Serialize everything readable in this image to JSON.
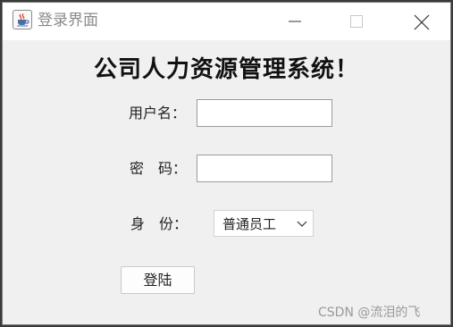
{
  "window": {
    "title": "登录界面",
    "icon": "java-cup-icon",
    "controls": [
      "minimize-icon",
      "maximize-icon",
      "close-icon"
    ]
  },
  "form": {
    "heading": "公司人力资源管理系统！",
    "username_label": "用户名：",
    "username_value": "",
    "password_label": "密　码：",
    "password_value": "",
    "role_label": "身　份：",
    "role_selected": "普通员工",
    "login_button": "登陆"
  },
  "watermark": "CSDN @流泪的飞",
  "colors": {
    "window_bg": "#f0f0f0",
    "titlebar_bg": "#ffffff",
    "title_text": "#8a8a8a"
  }
}
